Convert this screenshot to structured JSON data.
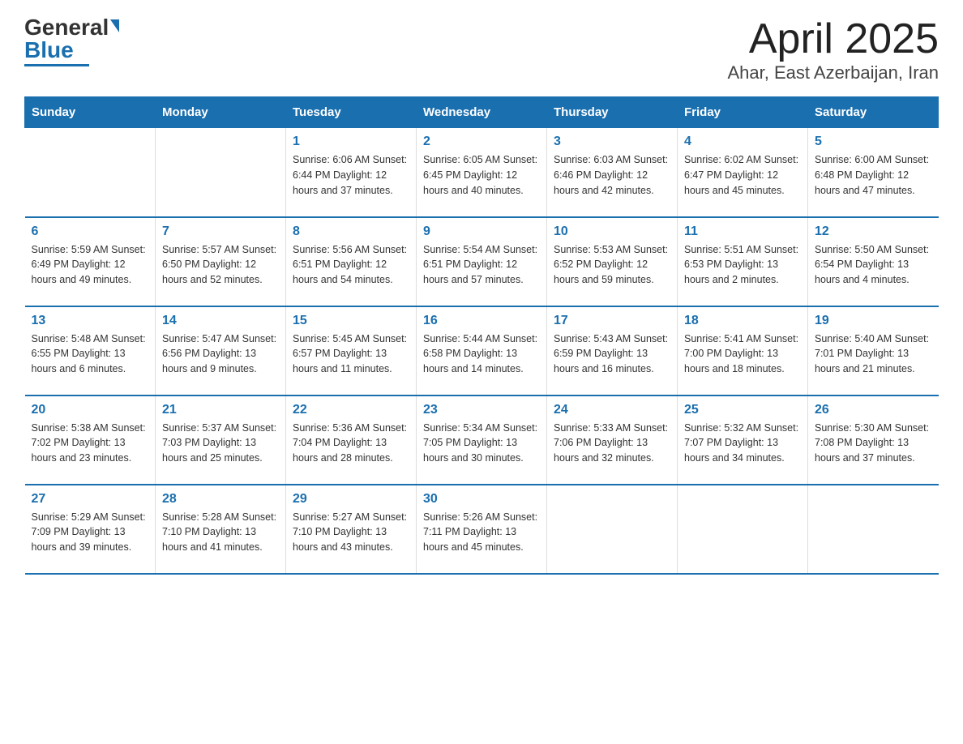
{
  "header": {
    "logo_general": "General",
    "logo_blue": "Blue",
    "title": "April 2025",
    "subtitle": "Ahar, East Azerbaijan, Iran"
  },
  "days_of_week": [
    "Sunday",
    "Monday",
    "Tuesday",
    "Wednesday",
    "Thursday",
    "Friday",
    "Saturday"
  ],
  "weeks": [
    [
      {
        "day": "",
        "info": ""
      },
      {
        "day": "",
        "info": ""
      },
      {
        "day": "1",
        "info": "Sunrise: 6:06 AM\nSunset: 6:44 PM\nDaylight: 12 hours\nand 37 minutes."
      },
      {
        "day": "2",
        "info": "Sunrise: 6:05 AM\nSunset: 6:45 PM\nDaylight: 12 hours\nand 40 minutes."
      },
      {
        "day": "3",
        "info": "Sunrise: 6:03 AM\nSunset: 6:46 PM\nDaylight: 12 hours\nand 42 minutes."
      },
      {
        "day": "4",
        "info": "Sunrise: 6:02 AM\nSunset: 6:47 PM\nDaylight: 12 hours\nand 45 minutes."
      },
      {
        "day": "5",
        "info": "Sunrise: 6:00 AM\nSunset: 6:48 PM\nDaylight: 12 hours\nand 47 minutes."
      }
    ],
    [
      {
        "day": "6",
        "info": "Sunrise: 5:59 AM\nSunset: 6:49 PM\nDaylight: 12 hours\nand 49 minutes."
      },
      {
        "day": "7",
        "info": "Sunrise: 5:57 AM\nSunset: 6:50 PM\nDaylight: 12 hours\nand 52 minutes."
      },
      {
        "day": "8",
        "info": "Sunrise: 5:56 AM\nSunset: 6:51 PM\nDaylight: 12 hours\nand 54 minutes."
      },
      {
        "day": "9",
        "info": "Sunrise: 5:54 AM\nSunset: 6:51 PM\nDaylight: 12 hours\nand 57 minutes."
      },
      {
        "day": "10",
        "info": "Sunrise: 5:53 AM\nSunset: 6:52 PM\nDaylight: 12 hours\nand 59 minutes."
      },
      {
        "day": "11",
        "info": "Sunrise: 5:51 AM\nSunset: 6:53 PM\nDaylight: 13 hours\nand 2 minutes."
      },
      {
        "day": "12",
        "info": "Sunrise: 5:50 AM\nSunset: 6:54 PM\nDaylight: 13 hours\nand 4 minutes."
      }
    ],
    [
      {
        "day": "13",
        "info": "Sunrise: 5:48 AM\nSunset: 6:55 PM\nDaylight: 13 hours\nand 6 minutes."
      },
      {
        "day": "14",
        "info": "Sunrise: 5:47 AM\nSunset: 6:56 PM\nDaylight: 13 hours\nand 9 minutes."
      },
      {
        "day": "15",
        "info": "Sunrise: 5:45 AM\nSunset: 6:57 PM\nDaylight: 13 hours\nand 11 minutes."
      },
      {
        "day": "16",
        "info": "Sunrise: 5:44 AM\nSunset: 6:58 PM\nDaylight: 13 hours\nand 14 minutes."
      },
      {
        "day": "17",
        "info": "Sunrise: 5:43 AM\nSunset: 6:59 PM\nDaylight: 13 hours\nand 16 minutes."
      },
      {
        "day": "18",
        "info": "Sunrise: 5:41 AM\nSunset: 7:00 PM\nDaylight: 13 hours\nand 18 minutes."
      },
      {
        "day": "19",
        "info": "Sunrise: 5:40 AM\nSunset: 7:01 PM\nDaylight: 13 hours\nand 21 minutes."
      }
    ],
    [
      {
        "day": "20",
        "info": "Sunrise: 5:38 AM\nSunset: 7:02 PM\nDaylight: 13 hours\nand 23 minutes."
      },
      {
        "day": "21",
        "info": "Sunrise: 5:37 AM\nSunset: 7:03 PM\nDaylight: 13 hours\nand 25 minutes."
      },
      {
        "day": "22",
        "info": "Sunrise: 5:36 AM\nSunset: 7:04 PM\nDaylight: 13 hours\nand 28 minutes."
      },
      {
        "day": "23",
        "info": "Sunrise: 5:34 AM\nSunset: 7:05 PM\nDaylight: 13 hours\nand 30 minutes."
      },
      {
        "day": "24",
        "info": "Sunrise: 5:33 AM\nSunset: 7:06 PM\nDaylight: 13 hours\nand 32 minutes."
      },
      {
        "day": "25",
        "info": "Sunrise: 5:32 AM\nSunset: 7:07 PM\nDaylight: 13 hours\nand 34 minutes."
      },
      {
        "day": "26",
        "info": "Sunrise: 5:30 AM\nSunset: 7:08 PM\nDaylight: 13 hours\nand 37 minutes."
      }
    ],
    [
      {
        "day": "27",
        "info": "Sunrise: 5:29 AM\nSunset: 7:09 PM\nDaylight: 13 hours\nand 39 minutes."
      },
      {
        "day": "28",
        "info": "Sunrise: 5:28 AM\nSunset: 7:10 PM\nDaylight: 13 hours\nand 41 minutes."
      },
      {
        "day": "29",
        "info": "Sunrise: 5:27 AM\nSunset: 7:10 PM\nDaylight: 13 hours\nand 43 minutes."
      },
      {
        "day": "30",
        "info": "Sunrise: 5:26 AM\nSunset: 7:11 PM\nDaylight: 13 hours\nand 45 minutes."
      },
      {
        "day": "",
        "info": ""
      },
      {
        "day": "",
        "info": ""
      },
      {
        "day": "",
        "info": ""
      }
    ]
  ]
}
